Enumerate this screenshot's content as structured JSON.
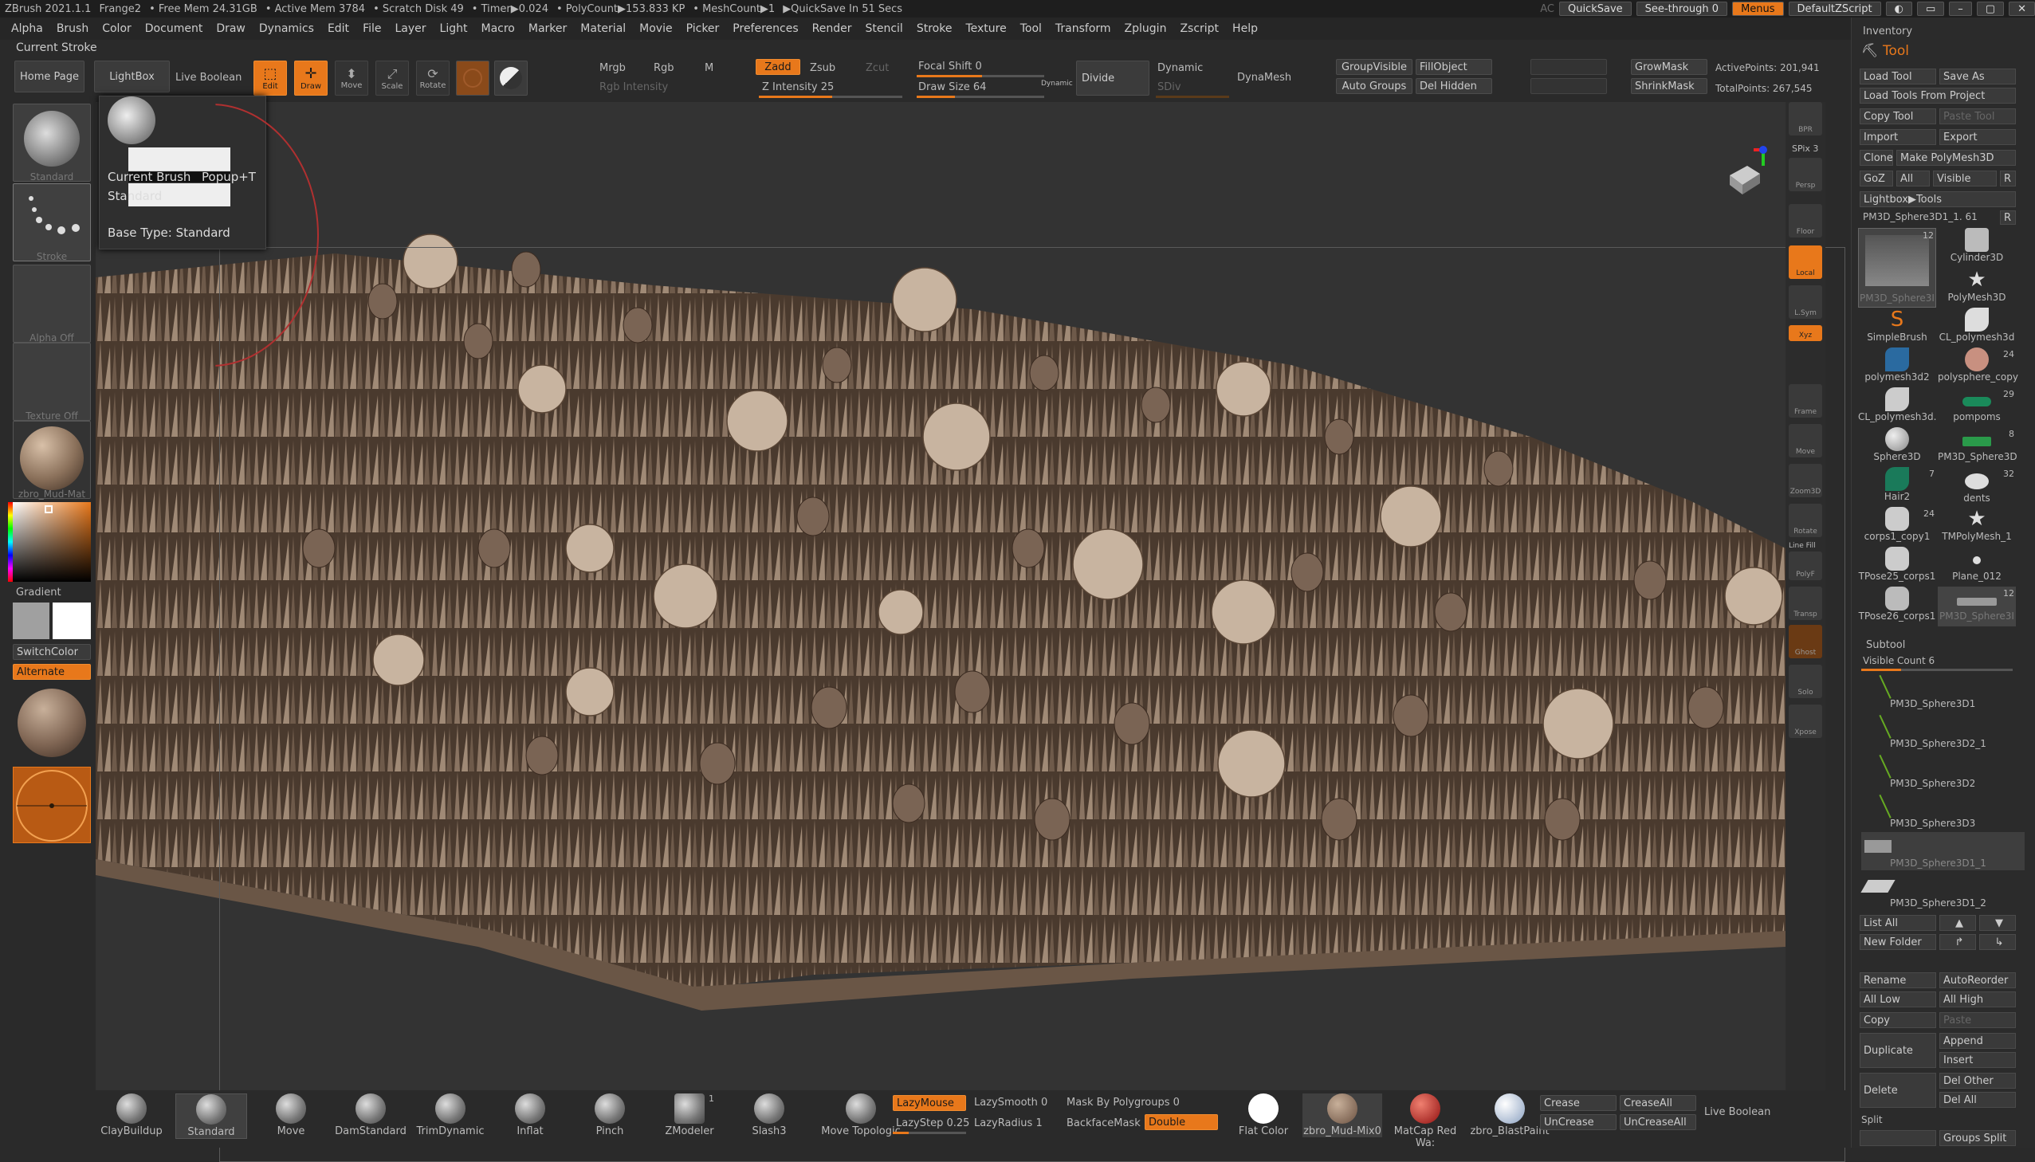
{
  "titlebar": {
    "app": "ZBrush 2021.1.1",
    "doc": "Frange2",
    "freemem": "• Free Mem 24.31GB",
    "activemem": "• Active Mem 3784",
    "scratch": "• Scratch Disk 49",
    "timer": "• Timer▶0.024",
    "polycount": "• PolyCount▶153.833 KP",
    "meshcount": "• MeshCount▶1",
    "quicksave": "▶QuickSave In 51 Secs",
    "ac": "AC",
    "quicksave_btn": "QuickSave",
    "seethrough": "See-through  0",
    "menus": "Menus",
    "defaultscript": "DefaultZScript"
  },
  "menu": [
    "Alpha",
    "Brush",
    "Color",
    "Document",
    "Draw",
    "Dynamics",
    "Edit",
    "File",
    "Layer",
    "Light",
    "Macro",
    "Marker",
    "Material",
    "Movie",
    "Picker",
    "Preferences",
    "Render",
    "Stencil",
    "Stroke",
    "Texture",
    "Tool",
    "Transform",
    "Zplugin",
    "Zscript",
    "Help"
  ],
  "current_stroke": "Current Stroke",
  "shelf": {
    "home": "Home Page",
    "lightbox": "LightBox",
    "liveboolean": "Live Boolean",
    "edit": "Edit",
    "draw": "Draw",
    "move": "Move",
    "scale": "Scale",
    "rotate": "Rotate",
    "mrgb": "Mrgb",
    "rgb": "Rgb",
    "m": "M",
    "rgb_intensity": "Rgb Intensity",
    "zadd": "Zadd",
    "zsub": "Zsub",
    "zcut": "Zcut",
    "z_intensity": "Z Intensity 25",
    "focal_shift": "Focal Shift 0",
    "draw_size": "Draw Size 64",
    "dynamic_small": "Dynamic",
    "divide": "Divide",
    "dynamic": "Dynamic",
    "sdiv": "SDiv",
    "dynamesh": "DynaMesh",
    "groupvisible": "GroupVisible",
    "fillobject": "FillObject",
    "autogroups": "Auto Groups",
    "delhidden": "Del Hidden",
    "growmask": "GrowMask",
    "shrinkmask": "ShrinkMask",
    "activepoints": "ActivePoints: 201,941",
    "totalpoints": "TotalPoints: 267,545"
  },
  "tooltip": {
    "title": "Current Brush",
    "shortcut": "Popup+T",
    "name": "Standard",
    "basetype": "Base Type: Standard"
  },
  "left": {
    "standard": "Standard",
    "stroke": "Stroke",
    "alpha": "Alpha Off",
    "texture": "Texture Off",
    "material": "zbro_Mud-Mat",
    "gradient": "Gradient",
    "switchcolor": "SwitchColor",
    "alternate": "Alternate"
  },
  "rightstrip": [
    "BPR",
    "SPix 3",
    "Persp",
    "Floor",
    "Local",
    "L.Sym",
    "Xyz",
    "Frame",
    "Move",
    "Zoom3D",
    "Rotate",
    "Line Fill",
    "PolyF",
    "Transp",
    "Ghost",
    "Solo",
    "Xpose"
  ],
  "sidebar": {
    "inventory": "Inventory",
    "tool": "Tool",
    "load_tool": "Load Tool",
    "save_as": "Save As",
    "load_from_project": "Load Tools From Project",
    "copy_tool": "Copy Tool",
    "paste_tool": "Paste Tool",
    "import": "Import",
    "export": "Export",
    "clone": "Clone",
    "make_polymesh": "Make PolyMesh3D",
    "goz": "GoZ",
    "all": "All",
    "visible": "Visible",
    "r": "R",
    "lightbox_tools": "Lightbox▶Tools",
    "current_tool": "PM3D_Sphere3D1_1. 61",
    "r2": "R",
    "tools": [
      {
        "name": "PM3D_Sphere3I",
        "count": "12"
      },
      {
        "name": "Cylinder3D",
        "count": ""
      },
      {
        "name": "PolyMesh3D",
        "count": ""
      },
      {
        "name": "SimpleBrush",
        "count": ""
      },
      {
        "name": "CL_polymesh3d",
        "count": ""
      },
      {
        "name": "polymesh3d2",
        "count": ""
      },
      {
        "name": "polysphere_copy",
        "count": "24"
      },
      {
        "name": "CL_polymesh3d.",
        "count": ""
      },
      {
        "name": "pompoms",
        "count": "29"
      },
      {
        "name": "Sphere3D",
        "count": ""
      },
      {
        "name": "PM3D_Sphere3D",
        "count": "8"
      },
      {
        "name": "Hair2",
        "count": "7"
      },
      {
        "name": "dents",
        "count": "32"
      },
      {
        "name": "corps1_copy1",
        "count": "24"
      },
      {
        "name": "TMPolyMesh_1",
        "count": ""
      },
      {
        "name": "TPose25_corps1",
        "count": ""
      },
      {
        "name": "Plane_012",
        "count": ""
      },
      {
        "name": "TPose26_corps1",
        "count": ""
      },
      {
        "name": "PM3D_Sphere3I",
        "count": "12"
      }
    ],
    "subtool": "Subtool",
    "visible_count": "Visible Count 6",
    "subtools": [
      "PM3D_Sphere3D1",
      "PM3D_Sphere3D2_1",
      "PM3D_Sphere3D2",
      "PM3D_Sphere3D3",
      "PM3D_Sphere3D1_1",
      "PM3D_Sphere3D1_2"
    ],
    "list_all": "List All",
    "new_folder": "New Folder",
    "rename": "Rename",
    "autoreorder": "AutoReorder",
    "all_low": "All Low",
    "all_high": "All High",
    "copy": "Copy",
    "paste": "Paste",
    "duplicate": "Duplicate",
    "append": "Append",
    "insert": "Insert",
    "delete": "Delete",
    "del_other": "Del Other",
    "del_all": "Del All",
    "split": "Split",
    "groups_split": "Groups Split"
  },
  "bottom": {
    "brushes": [
      "ClayBuildup",
      "Standard",
      "Move",
      "DamStandard",
      "TrimDynamic",
      "Inflat",
      "Pinch",
      "ZModeler",
      "Slash3",
      "Move Topologic"
    ],
    "zmodeler_count": "1",
    "lazymouse": "LazyMouse",
    "lazysmooth": "LazySmooth 0",
    "lazystep": "LazyStep 0.25",
    "lazyradius": "LazyRadius 1",
    "maskbypoly": "Mask By Polygroups 0",
    "backfacemask": "BackfaceMask",
    "double": "Double",
    "materials": [
      "Flat Color",
      "zbro_Mud-Mix0",
      "MatCap Red Wa:",
      "zbro_BlastPaint"
    ],
    "crease": "Crease",
    "creaseall": "CreaseAll",
    "uncrease": "UnCrease",
    "uncreaseall": "UnCreaseAll",
    "liveboolean": "Live Boolean"
  }
}
